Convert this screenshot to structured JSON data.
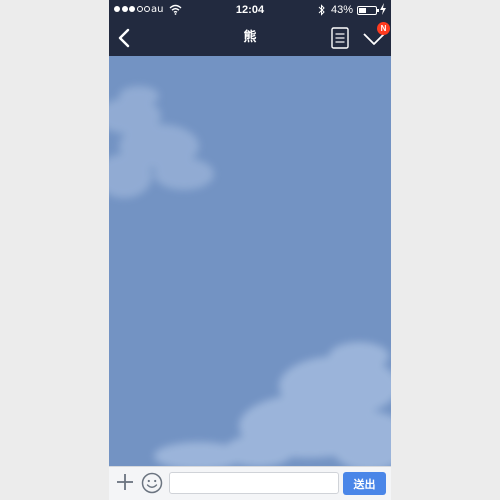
{
  "status_bar": {
    "carrier": "au",
    "time": "12:04",
    "battery_percent": "43%",
    "battery_level": 0.43,
    "signal_bars_filled": 3,
    "signal_bars_total": 5,
    "icons": [
      "wifi-icon",
      "bluetooth-icon",
      "battery-icon",
      "charging-bolt-icon"
    ]
  },
  "header": {
    "title": "熊",
    "back_icon": "chevron-left-icon",
    "notes_icon": "note-icon",
    "menu_icon": "checkmark-chevron-icon",
    "badge": "N"
  },
  "chat": {
    "background": "sky-with-clouds",
    "background_color": "#7393c3"
  },
  "composer": {
    "add_icon": "plus-icon",
    "emoji_icon": "smiley-icon",
    "input_value": "",
    "input_placeholder": "",
    "send_label": "送出"
  },
  "colors": {
    "header_bg": "#222a3f",
    "send_button": "#4a86e8",
    "badge": "#ff3b1f"
  }
}
